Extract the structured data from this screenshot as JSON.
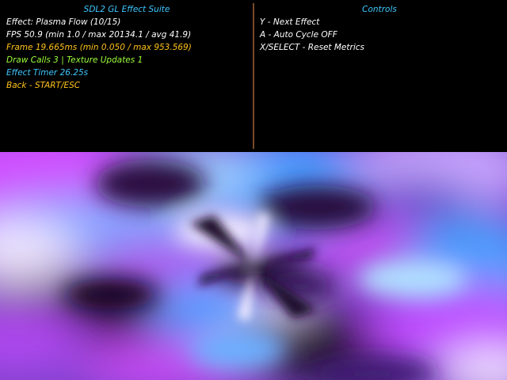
{
  "window": {
    "title": "SDL2 GL Effect Suite"
  },
  "stats": {
    "effect": "Effect: Plasma Flow (10/15)",
    "fps": "FPS 50.9 (min 1.0 / max 20134.1 / avg 41.9)",
    "frame": "Frame 19.665ms (min 0.050 / max 953.569)",
    "draw": "Draw Calls 3 | Texture Updates 1",
    "timer": "Effect Timer 26.25s",
    "back": "Back - START/ESC"
  },
  "controls": {
    "title": "Controls",
    "items": [
      "Y - Next Effect",
      "A - Auto Cycle OFF",
      "X/SELECT - Reset Metrics"
    ]
  },
  "colors": {
    "title": "#3ec7ff",
    "text": "#ffffff",
    "frame": "#ffc21a",
    "draw": "#9cff3a",
    "timer": "#3ec7ff",
    "back": "#ffc21a",
    "divider": "#7a4a2a",
    "plasma_magenta": "#c048ff",
    "plasma_blue": "#4a9cff",
    "plasma_dark": "#1a0a2a",
    "plasma_light": "#f0e6ff"
  }
}
